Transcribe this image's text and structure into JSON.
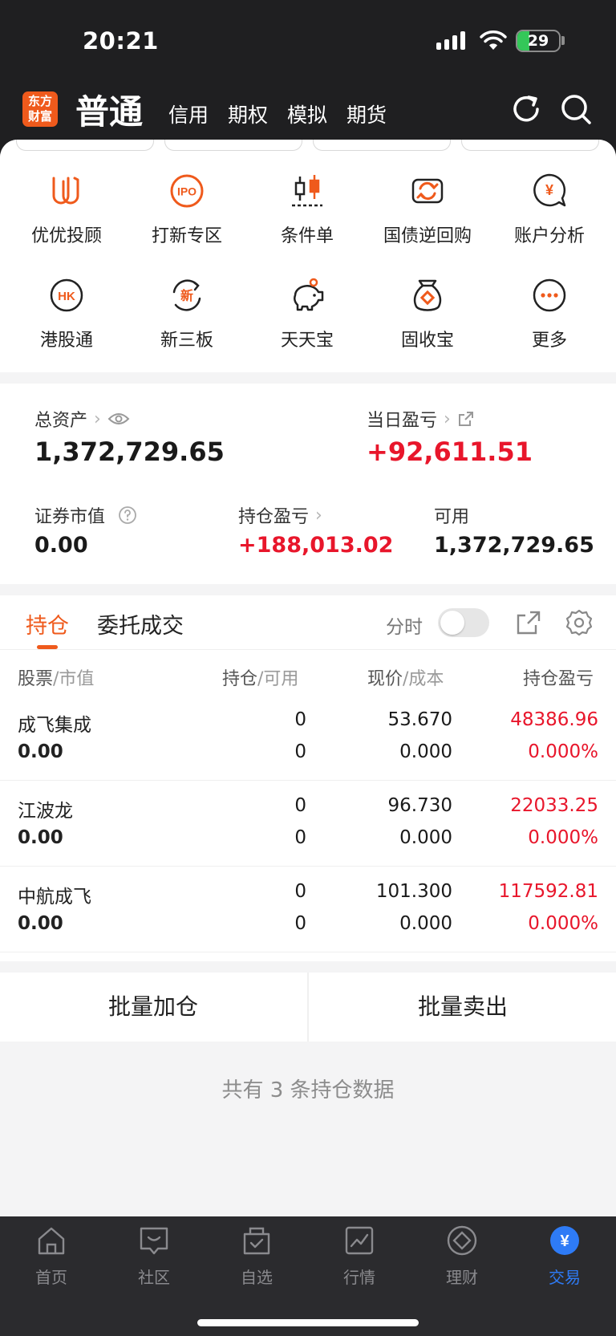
{
  "status_bar": {
    "time": "20:21",
    "battery": "29",
    "battery_level": 0.29
  },
  "header": {
    "title": "普通",
    "tabs": [
      "信用",
      "期权",
      "模拟",
      "期货"
    ],
    "logo_text": "东方财富"
  },
  "quick_menu": [
    {
      "label": "优优投顾",
      "icon": "uu-advisor-icon"
    },
    {
      "label": "打新专区",
      "icon": "ipo-icon",
      "badge": "IPO"
    },
    {
      "label": "条件单",
      "icon": "candlestick-icon"
    },
    {
      "label": "国债逆回购",
      "icon": "repo-icon"
    },
    {
      "label": "账户分析",
      "icon": "yuan-chat-icon",
      "badge": "¥"
    },
    {
      "label": "港股通",
      "icon": "hk-icon",
      "badge": "HK"
    },
    {
      "label": "新三板",
      "icon": "new-board-icon",
      "badge": "新"
    },
    {
      "label": "天天宝",
      "icon": "piggy-bank-icon"
    },
    {
      "label": "固收宝",
      "icon": "money-bag-icon"
    },
    {
      "label": "更多",
      "icon": "more-icon"
    }
  ],
  "assets": {
    "total_label": "总资产",
    "total_value": "1,372,729.65",
    "daily_label": "当日盈亏",
    "daily_value": "+92,611.51",
    "market_label": "证券市值",
    "market_value": "0.00",
    "holding_pl_label": "持仓盈亏",
    "holding_pl_value": "+188,013.02",
    "available_label": "可用",
    "available_value": "1,372,729.65"
  },
  "positions": {
    "tab_active": "持仓",
    "tab_other": "委托成交",
    "fenshi_label": "分时",
    "toggle_on": false,
    "headers": {
      "stock": "股票",
      "stock_sub": "/市值",
      "hold": "持仓",
      "hold_sub": "/可用",
      "price": "现价",
      "price_sub": "/成本",
      "pl": "持仓盈亏"
    },
    "rows": [
      {
        "name": "成飞集成",
        "market_value": "0.00",
        "hold": "0",
        "available": "0",
        "price": "53.670",
        "cost": "0.000",
        "pl": "48386.96",
        "pl_pct": "0.000%"
      },
      {
        "name": "江波龙",
        "market_value": "0.00",
        "hold": "0",
        "available": "0",
        "price": "96.730",
        "cost": "0.000",
        "pl": "22033.25",
        "pl_pct": "0.000%"
      },
      {
        "name": "中航成飞",
        "market_value": "0.00",
        "hold": "0",
        "available": "0",
        "price": "101.300",
        "cost": "0.000",
        "pl": "117592.81",
        "pl_pct": "0.000%"
      }
    ]
  },
  "actions": {
    "batch_add": "批量加仓",
    "batch_sell": "批量卖出"
  },
  "summary": "共有 3 条持仓数据",
  "bottom_nav": [
    {
      "label": "首页",
      "icon": "home-icon"
    },
    {
      "label": "社区",
      "icon": "community-icon"
    },
    {
      "label": "自选",
      "icon": "watchlist-icon"
    },
    {
      "label": "行情",
      "icon": "market-chart-icon"
    },
    {
      "label": "理财",
      "icon": "wealth-icon"
    },
    {
      "label": "交易",
      "icon": "trade-yuan-icon",
      "badge": "¥",
      "active": true
    }
  ],
  "colors": {
    "accent": "#ef5a1c",
    "gain": "#e8162b",
    "nav_active": "#2e7bf6"
  }
}
